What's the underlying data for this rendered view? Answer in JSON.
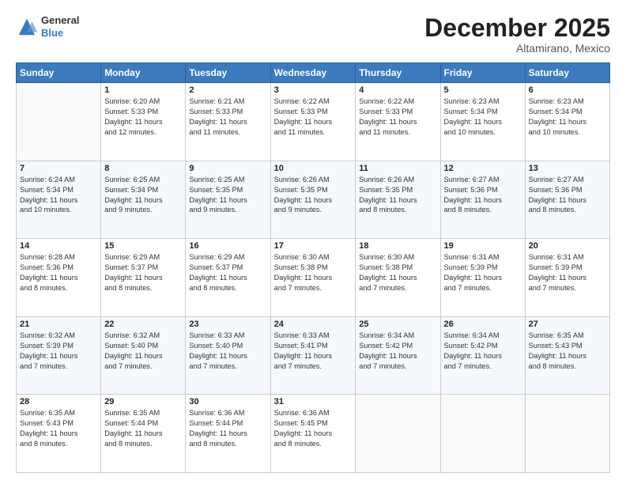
{
  "logo": {
    "general": "General",
    "blue": "Blue"
  },
  "header": {
    "month": "December 2025",
    "location": "Altamirano, Mexico"
  },
  "weekdays": [
    "Sunday",
    "Monday",
    "Tuesday",
    "Wednesday",
    "Thursday",
    "Friday",
    "Saturday"
  ],
  "weeks": [
    [
      {
        "day": "",
        "info": ""
      },
      {
        "day": "1",
        "info": "Sunrise: 6:20 AM\nSunset: 5:33 PM\nDaylight: 11 hours\nand 12 minutes."
      },
      {
        "day": "2",
        "info": "Sunrise: 6:21 AM\nSunset: 5:33 PM\nDaylight: 11 hours\nand 11 minutes."
      },
      {
        "day": "3",
        "info": "Sunrise: 6:22 AM\nSunset: 5:33 PM\nDaylight: 11 hours\nand 11 minutes."
      },
      {
        "day": "4",
        "info": "Sunrise: 6:22 AM\nSunset: 5:33 PM\nDaylight: 11 hours\nand 11 minutes."
      },
      {
        "day": "5",
        "info": "Sunrise: 6:23 AM\nSunset: 5:34 PM\nDaylight: 11 hours\nand 10 minutes."
      },
      {
        "day": "6",
        "info": "Sunrise: 6:23 AM\nSunset: 5:34 PM\nDaylight: 11 hours\nand 10 minutes."
      }
    ],
    [
      {
        "day": "7",
        "info": "Sunrise: 6:24 AM\nSunset: 5:34 PM\nDaylight: 11 hours\nand 10 minutes."
      },
      {
        "day": "8",
        "info": "Sunrise: 6:25 AM\nSunset: 5:34 PM\nDaylight: 11 hours\nand 9 minutes."
      },
      {
        "day": "9",
        "info": "Sunrise: 6:25 AM\nSunset: 5:35 PM\nDaylight: 11 hours\nand 9 minutes."
      },
      {
        "day": "10",
        "info": "Sunrise: 6:26 AM\nSunset: 5:35 PM\nDaylight: 11 hours\nand 9 minutes."
      },
      {
        "day": "11",
        "info": "Sunrise: 6:26 AM\nSunset: 5:35 PM\nDaylight: 11 hours\nand 8 minutes."
      },
      {
        "day": "12",
        "info": "Sunrise: 6:27 AM\nSunset: 5:36 PM\nDaylight: 11 hours\nand 8 minutes."
      },
      {
        "day": "13",
        "info": "Sunrise: 6:27 AM\nSunset: 5:36 PM\nDaylight: 11 hours\nand 8 minutes."
      }
    ],
    [
      {
        "day": "14",
        "info": "Sunrise: 6:28 AM\nSunset: 5:36 PM\nDaylight: 11 hours\nand 8 minutes."
      },
      {
        "day": "15",
        "info": "Sunrise: 6:29 AM\nSunset: 5:37 PM\nDaylight: 11 hours\nand 8 minutes."
      },
      {
        "day": "16",
        "info": "Sunrise: 6:29 AM\nSunset: 5:37 PM\nDaylight: 11 hours\nand 8 minutes."
      },
      {
        "day": "17",
        "info": "Sunrise: 6:30 AM\nSunset: 5:38 PM\nDaylight: 11 hours\nand 7 minutes."
      },
      {
        "day": "18",
        "info": "Sunrise: 6:30 AM\nSunset: 5:38 PM\nDaylight: 11 hours\nand 7 minutes."
      },
      {
        "day": "19",
        "info": "Sunrise: 6:31 AM\nSunset: 5:39 PM\nDaylight: 11 hours\nand 7 minutes."
      },
      {
        "day": "20",
        "info": "Sunrise: 6:31 AM\nSunset: 5:39 PM\nDaylight: 11 hours\nand 7 minutes."
      }
    ],
    [
      {
        "day": "21",
        "info": "Sunrise: 6:32 AM\nSunset: 5:39 PM\nDaylight: 11 hours\nand 7 minutes."
      },
      {
        "day": "22",
        "info": "Sunrise: 6:32 AM\nSunset: 5:40 PM\nDaylight: 11 hours\nand 7 minutes."
      },
      {
        "day": "23",
        "info": "Sunrise: 6:33 AM\nSunset: 5:40 PM\nDaylight: 11 hours\nand 7 minutes."
      },
      {
        "day": "24",
        "info": "Sunrise: 6:33 AM\nSunset: 5:41 PM\nDaylight: 11 hours\nand 7 minutes."
      },
      {
        "day": "25",
        "info": "Sunrise: 6:34 AM\nSunset: 5:42 PM\nDaylight: 11 hours\nand 7 minutes."
      },
      {
        "day": "26",
        "info": "Sunrise: 6:34 AM\nSunset: 5:42 PM\nDaylight: 11 hours\nand 7 minutes."
      },
      {
        "day": "27",
        "info": "Sunrise: 6:35 AM\nSunset: 5:43 PM\nDaylight: 11 hours\nand 8 minutes."
      }
    ],
    [
      {
        "day": "28",
        "info": "Sunrise: 6:35 AM\nSunset: 5:43 PM\nDaylight: 11 hours\nand 8 minutes."
      },
      {
        "day": "29",
        "info": "Sunrise: 6:35 AM\nSunset: 5:44 PM\nDaylight: 11 hours\nand 8 minutes."
      },
      {
        "day": "30",
        "info": "Sunrise: 6:36 AM\nSunset: 5:44 PM\nDaylight: 11 hours\nand 8 minutes."
      },
      {
        "day": "31",
        "info": "Sunrise: 6:36 AM\nSunset: 5:45 PM\nDaylight: 11 hours\nand 8 minutes."
      },
      {
        "day": "",
        "info": ""
      },
      {
        "day": "",
        "info": ""
      },
      {
        "day": "",
        "info": ""
      }
    ]
  ]
}
